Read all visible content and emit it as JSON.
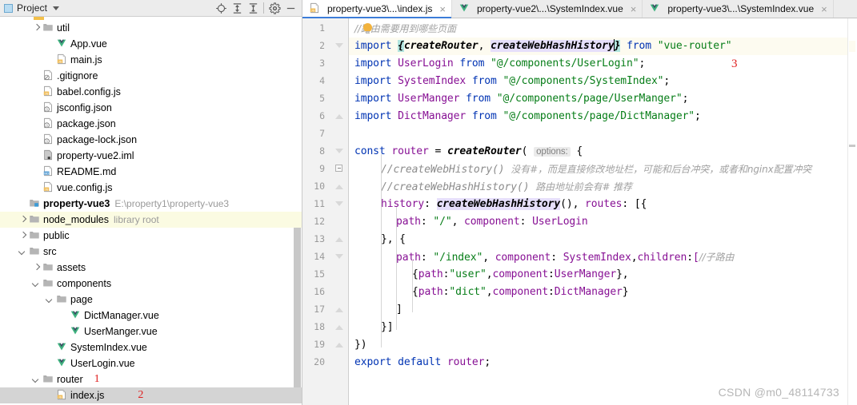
{
  "sidebar": {
    "panel_title": "Project",
    "icons": [
      {
        "name": "locate-icon",
        "glyph": "locate"
      },
      {
        "name": "expand-all-icon",
        "glyph": "expand-all"
      },
      {
        "name": "collapse-all-icon",
        "glyph": "collapse-all"
      },
      {
        "name": "settings-gear-icon",
        "glyph": "gear"
      },
      {
        "name": "hide-panel-icon",
        "glyph": "minus"
      }
    ],
    "tree": [
      {
        "label": "util",
        "indent": 2,
        "arrow": "right",
        "icon": "folder",
        "bold": false,
        "sub": "",
        "red": "",
        "state": "normal"
      },
      {
        "label": "App.vue",
        "indent": 3,
        "arrow": "none",
        "icon": "vue",
        "bold": false,
        "sub": "",
        "red": "",
        "state": "normal"
      },
      {
        "label": "main.js",
        "indent": 3,
        "arrow": "none",
        "icon": "js",
        "bold": false,
        "sub": "",
        "red": "",
        "state": "normal"
      },
      {
        "label": ".gitignore",
        "indent": 2,
        "arrow": "none",
        "icon": "gitignore",
        "bold": false,
        "sub": "",
        "red": "",
        "state": "normal"
      },
      {
        "label": "babel.config.js",
        "indent": 2,
        "arrow": "none",
        "icon": "js",
        "bold": false,
        "sub": "",
        "red": "",
        "state": "normal"
      },
      {
        "label": "jsconfig.json",
        "indent": 2,
        "arrow": "none",
        "icon": "json",
        "bold": false,
        "sub": "",
        "red": "",
        "state": "normal"
      },
      {
        "label": "package.json",
        "indent": 2,
        "arrow": "none",
        "icon": "json",
        "bold": false,
        "sub": "",
        "red": "",
        "state": "normal"
      },
      {
        "label": "package-lock.json",
        "indent": 2,
        "arrow": "none",
        "icon": "json",
        "bold": false,
        "sub": "",
        "red": "",
        "state": "normal"
      },
      {
        "label": "property-vue2.iml",
        "indent": 2,
        "arrow": "none",
        "icon": "iml",
        "bold": false,
        "sub": "",
        "red": "",
        "state": "normal"
      },
      {
        "label": "README.md",
        "indent": 2,
        "arrow": "none",
        "icon": "md",
        "bold": false,
        "sub": "",
        "red": "",
        "state": "normal"
      },
      {
        "label": "vue.config.js",
        "indent": 2,
        "arrow": "none",
        "icon": "js",
        "bold": false,
        "sub": "",
        "red": "",
        "state": "normal"
      },
      {
        "label": "property-vue3",
        "indent": 1,
        "arrow": "none",
        "icon": "module",
        "bold": true,
        "sub": "E:\\property1\\property-vue3",
        "red": "",
        "state": "normal"
      },
      {
        "label": "node_modules",
        "indent": 1,
        "arrow": "right",
        "icon": "folder",
        "bold": false,
        "sub": "library root",
        "red": "",
        "state": "yellow"
      },
      {
        "label": "public",
        "indent": 1,
        "arrow": "right",
        "icon": "folder",
        "bold": false,
        "sub": "",
        "red": "",
        "state": "normal"
      },
      {
        "label": "src",
        "indent": 1,
        "arrow": "down",
        "icon": "folder",
        "bold": false,
        "sub": "",
        "red": "",
        "state": "normal"
      },
      {
        "label": "assets",
        "indent": 2,
        "arrow": "right",
        "icon": "folder",
        "bold": false,
        "sub": "",
        "red": "",
        "state": "normal"
      },
      {
        "label": "components",
        "indent": 2,
        "arrow": "down",
        "icon": "folder",
        "bold": false,
        "sub": "",
        "red": "",
        "state": "normal"
      },
      {
        "label": "page",
        "indent": 3,
        "arrow": "down",
        "icon": "folder",
        "bold": false,
        "sub": "",
        "red": "",
        "state": "normal"
      },
      {
        "label": "DictManager.vue",
        "indent": 4,
        "arrow": "none",
        "icon": "vue",
        "bold": false,
        "sub": "",
        "red": "",
        "state": "normal"
      },
      {
        "label": "UserManger.vue",
        "indent": 4,
        "arrow": "none",
        "icon": "vue",
        "bold": false,
        "sub": "",
        "red": "",
        "state": "normal"
      },
      {
        "label": "SystemIndex.vue",
        "indent": 3,
        "arrow": "none",
        "icon": "vue",
        "bold": false,
        "sub": "",
        "red": "",
        "state": "normal"
      },
      {
        "label": "UserLogin.vue",
        "indent": 3,
        "arrow": "none",
        "icon": "vue",
        "bold": false,
        "sub": "",
        "red": "",
        "state": "normal"
      },
      {
        "label": "router",
        "indent": 2,
        "arrow": "down",
        "icon": "folder",
        "bold": false,
        "sub": "",
        "red": "1",
        "state": "normal"
      },
      {
        "label": "index.js",
        "indent": 3,
        "arrow": "none",
        "icon": "js",
        "bold": false,
        "sub": "",
        "red": "2",
        "state": "selected"
      }
    ]
  },
  "editor": {
    "tabs": [
      {
        "label": "property-vue3\\...\\index.js",
        "icon": "js",
        "active": true,
        "close": "×"
      },
      {
        "label": "property-vue2\\...\\SystemIndex.vue",
        "icon": "vue",
        "active": false,
        "close": "×"
      },
      {
        "label": "property-vue3\\...\\SystemIndex.vue",
        "icon": "vue",
        "active": false,
        "close": "×"
      }
    ],
    "line_numbers": [
      "1",
      "2",
      "3",
      "4",
      "5",
      "6",
      "7",
      "8",
      "9",
      "10",
      "11",
      "12",
      "13",
      "14",
      "15",
      "16",
      "17",
      "18",
      "19",
      "20"
    ],
    "current_line": 2,
    "annotations": [
      {
        "text": "3",
        "color": "#e02020"
      }
    ],
    "watermark": "CSDN @m0_48114733",
    "hint_label": "options:",
    "code": {
      "l1_comment": "//路由需要用到哪些页面",
      "l2": {
        "kw": "import",
        "brace_open": "{",
        "a": "createRouter",
        "comma": ", ",
        "b": "createWebHashHistory",
        "brace_close": "}",
        "from": "from",
        "mod": "\"vue-router\""
      },
      "l3": {
        "kw": "import",
        "name": "UserLogin",
        "from": "from",
        "mod": "\"@/components/UserLogin\"",
        "semi": ";"
      },
      "l4": {
        "kw": "import",
        "name": "SystemIndex",
        "from": "from",
        "mod": "\"@/components/SystemIndex\"",
        "semi": ";"
      },
      "l5": {
        "kw": "import",
        "name": "UserManger",
        "from": "from",
        "mod": "\"@/components/page/UserManger\"",
        "semi": ";"
      },
      "l6": {
        "kw": "import",
        "name": "DictManager",
        "from": "from",
        "mod": "\"@/components/page/DictManager\"",
        "semi": ";"
      },
      "l8": {
        "kw": "const",
        "name": "router",
        "eq": " = ",
        "fn": "createRouter",
        "paren": "(",
        "brace": "{"
      },
      "l9_comment": "//createWebHistory() 没有#，而是直接修改地址栏，可能和后台冲突，或者和nginx配置冲突",
      "l10_comment": "//createWebHashHistory() 路由地址前会有# 推荐",
      "l11": {
        "prop": "history",
        "colon": ": ",
        "fn": "createWebHashHistory",
        "call": "(), ",
        "prop2": "routes",
        "rest": ": [{"
      },
      "l12": {
        "prop": "path",
        "colon": ": ",
        "str": "\"/\"",
        "comma": ", ",
        "prop2": "component",
        "colon2": ": ",
        "val": "UserLogin"
      },
      "l13": "}, {",
      "l14": {
        "prop": "path",
        "colon": ": ",
        "str": "\"/index\"",
        "comma": ", ",
        "prop2": "component",
        "colon2": ": ",
        "val": "SystemIndex",
        "comma2": ",",
        "prop3": "children",
        "colon3": ":",
        "bracket": "[",
        "cmt": "//子路由"
      },
      "l15": {
        "open": "{",
        "prop": "path",
        "colon": ":",
        "str": "\"user\"",
        "comma": ",",
        "prop2": "component",
        "colon2": ":",
        "val": "UserManger",
        "close": "},"
      },
      "l16": {
        "open": "{",
        "prop": "path",
        "colon": ":",
        "str": "\"dict\"",
        "comma": ",",
        "prop2": "component",
        "colon2": ":",
        "val": "DictManager",
        "close": "}"
      },
      "l17": "]",
      "l18": "}]",
      "l19": "})",
      "l20": {
        "kw1": "export",
        "kw2": "default",
        "name": "router",
        "semi": ";"
      }
    }
  },
  "colors": {
    "keyword": "#0033b3",
    "string": "#067d17",
    "property": "#871094",
    "comment": "#8c8c8c",
    "accent": "#3c7dd9",
    "red_annotation": "#e02020",
    "highlight_cyan": "#b3e6e0",
    "highlight_purple": "#e6dffb",
    "current_line": "#fdfbf0"
  }
}
